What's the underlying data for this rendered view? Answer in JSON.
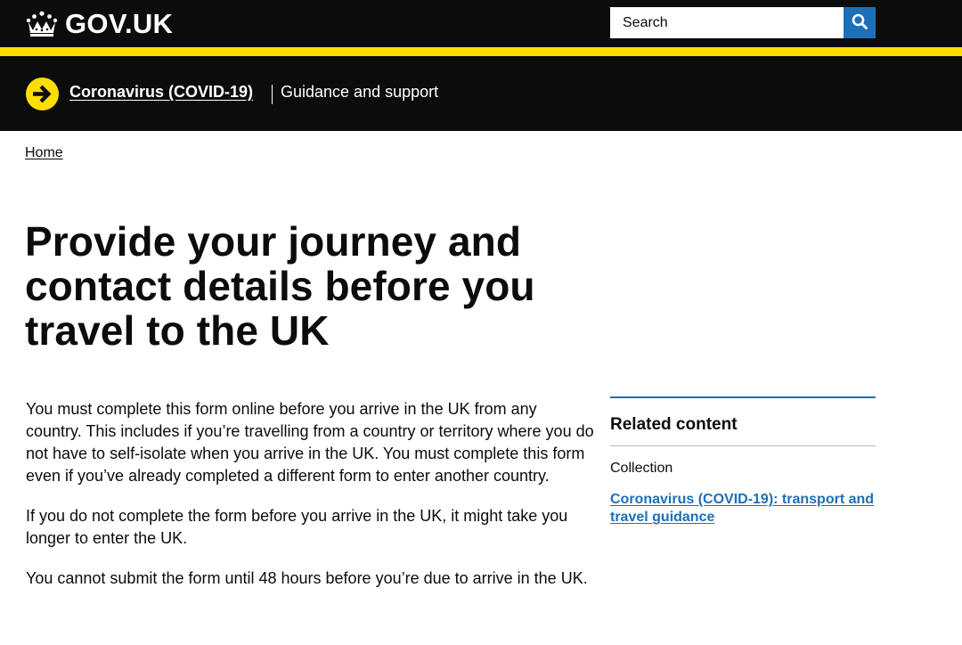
{
  "header": {
    "logo_text": "GOV.UK",
    "logo_icon": "crown-icon",
    "search": {
      "placeholder": "Search",
      "button_icon": "search-icon"
    }
  },
  "covid_banner": {
    "icon": "arrow-right-circle-icon",
    "link_label": "Coronavirus (COVID-19)",
    "tagline": "Guidance and support"
  },
  "breadcrumb": {
    "items": [
      {
        "label": "Home"
      }
    ]
  },
  "page": {
    "title": "Provide your journey and contact details before you travel to the UK",
    "paragraphs": [
      "You must complete this form online before you arrive in the UK from any country. This includes if you’re travelling from a country or territory where you do not have to self-isolate when you arrive in the UK. You must complete this form even if you’ve already completed a different form to enter another country.",
      "If you do not complete the form before you arrive in the UK, it might take you longer to enter the UK.",
      "You cannot submit the form until 48 hours before you’re due to arrive in the UK."
    ]
  },
  "related": {
    "heading": "Related content",
    "subheading": "Collection",
    "links": [
      {
        "label": "Coronavirus (COVID-19): transport and travel guidance"
      }
    ]
  },
  "colors": {
    "header_background": "#0b0c0c",
    "accent_yellow": "#ffdd00",
    "link_blue": "#1d70b8",
    "text": "#0b0c0c"
  }
}
